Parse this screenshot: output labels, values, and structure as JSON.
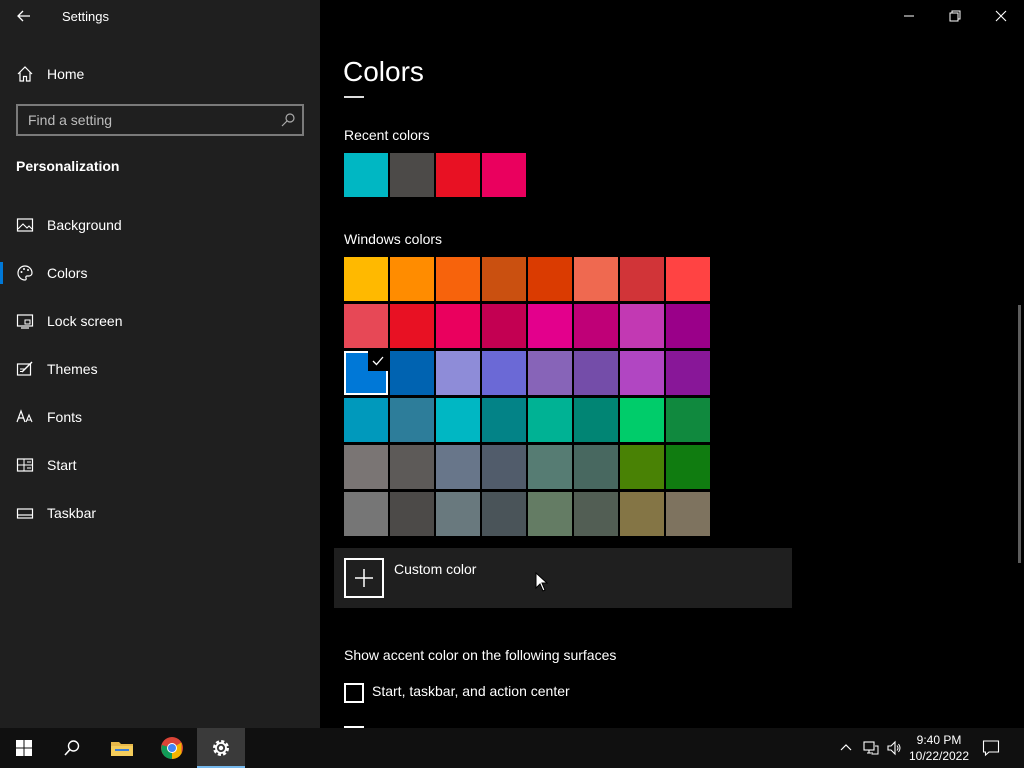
{
  "window": {
    "title": "Settings",
    "page_title": "Colors"
  },
  "sidebar": {
    "home_label": "Home",
    "search_placeholder": "Find a setting",
    "section_title": "Personalization",
    "items": [
      {
        "label": "Background",
        "icon": "picture-icon"
      },
      {
        "label": "Colors",
        "icon": "palette-icon",
        "active": true
      },
      {
        "label": "Lock screen",
        "icon": "lock-screen-icon"
      },
      {
        "label": "Themes",
        "icon": "themes-icon"
      },
      {
        "label": "Fonts",
        "icon": "fonts-icon"
      },
      {
        "label": "Start",
        "icon": "start-icon"
      },
      {
        "label": "Taskbar",
        "icon": "taskbar-icon"
      }
    ]
  },
  "main": {
    "recent_colors_label": "Recent colors",
    "recent_colors": [
      "#00b7c3",
      "#4c4a48",
      "#e81123",
      "#ea005e"
    ],
    "windows_colors_label": "Windows colors",
    "windows_colors": [
      [
        "#ffb900",
        "#ff8c00",
        "#f7630c",
        "#ca5010",
        "#da3b01",
        "#ef6950",
        "#d13438",
        "#ff4343"
      ],
      [
        "#e74856",
        "#e81123",
        "#ea005e",
        "#c30052",
        "#e3008c",
        "#bf0077",
        "#c239b3",
        "#9a0089"
      ],
      [
        "#0078d7",
        "#0063b1",
        "#8e8cd8",
        "#6b69d6",
        "#8764b8",
        "#744da9",
        "#b146c2",
        "#881798"
      ],
      [
        "#0099bc",
        "#2d7d9a",
        "#00b7c3",
        "#038387",
        "#00b294",
        "#018574",
        "#00cc6a",
        "#10893e"
      ],
      [
        "#7a7574",
        "#5d5a58",
        "#68768a",
        "#515c6b",
        "#567c73",
        "#486860",
        "#498205",
        "#107c10"
      ],
      [
        "#767676",
        "#4c4a48",
        "#69797e",
        "#4a5459",
        "#647c64",
        "#525e54",
        "#847545",
        "#7e735f"
      ]
    ],
    "selected_color": "#0078d7",
    "custom_color_label": "Custom color",
    "surfaces_label": "Show accent color on the following surfaces",
    "checkbox_start_label": "Start, taskbar, and action center"
  },
  "taskbar": {
    "time": "9:40 PM",
    "date": "10/22/2022"
  }
}
